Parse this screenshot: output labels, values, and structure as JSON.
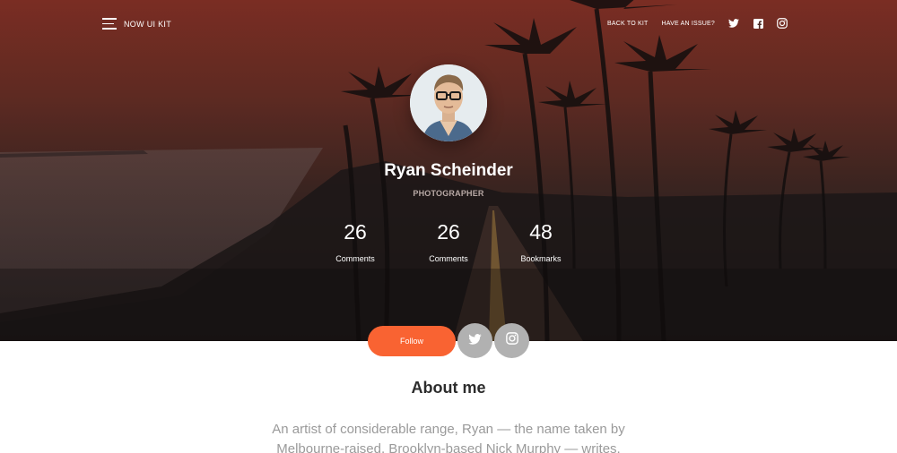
{
  "nav": {
    "brand": "NOW UI KIT",
    "links": [
      "BACK TO KIT",
      "HAVE AN ISSUE?"
    ],
    "icons": [
      "twitter-icon",
      "facebook-icon",
      "instagram-icon"
    ]
  },
  "profile": {
    "name": "Ryan Scheinder",
    "role": "PHOTOGRAPHER",
    "stats": [
      {
        "value": "26",
        "label": "Comments"
      },
      {
        "value": "26",
        "label": "Comments"
      },
      {
        "value": "48",
        "label": "Bookmarks"
      }
    ]
  },
  "actions": {
    "follow_label": "Follow",
    "social": [
      "twitter-icon",
      "instagram-icon"
    ]
  },
  "about": {
    "title": "About me",
    "text": "An artist of considerable range, Ryan — the name taken by Melbourne-raised, Brooklyn-based Nick Murphy — writes,"
  },
  "colors": {
    "accent": "#f96332",
    "social_button": "#b1b1b1",
    "heading": "#2c2c2c",
    "muted_text": "#9a9a9a"
  }
}
